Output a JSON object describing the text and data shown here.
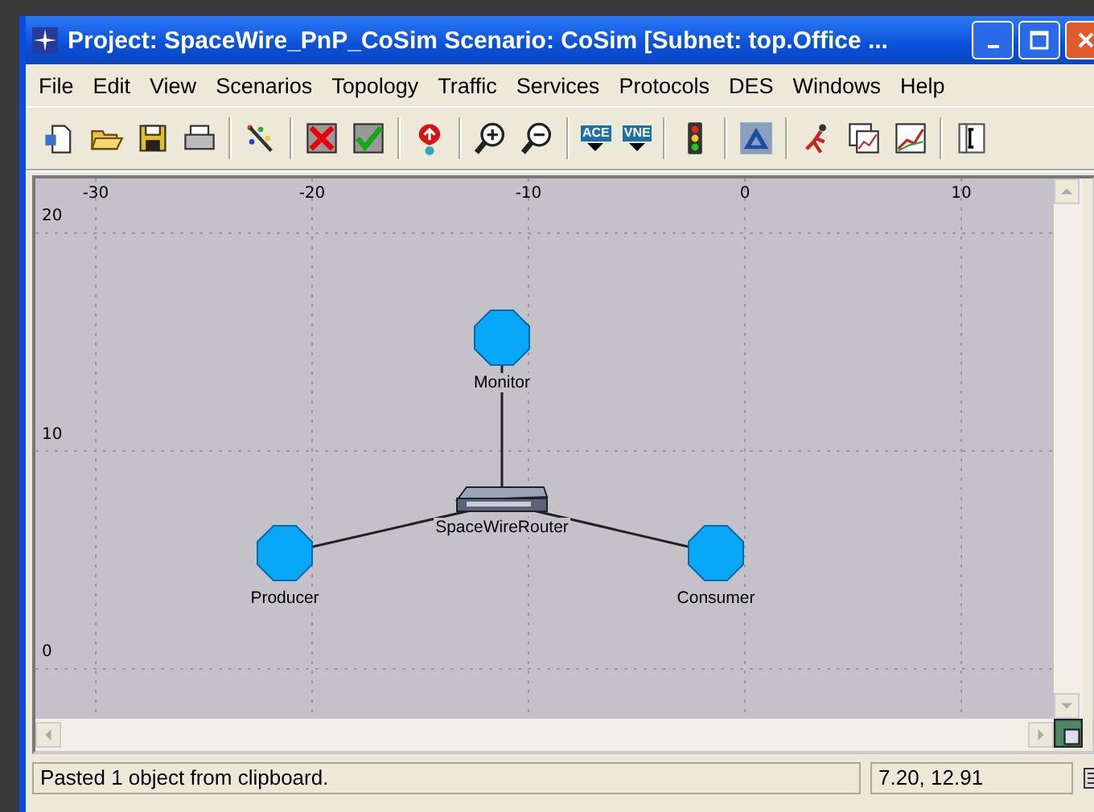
{
  "window": {
    "title": "Project: SpaceWire_PnP_CoSim Scenario: CoSim  [Subnet: top.Office ..."
  },
  "menu": [
    "File",
    "Edit",
    "View",
    "Scenarios",
    "Topology",
    "Traffic",
    "Services",
    "Protocols",
    "DES",
    "Windows",
    "Help"
  ],
  "toolbar": [
    {
      "kind": "new"
    },
    {
      "kind": "open"
    },
    {
      "kind": "save"
    },
    {
      "kind": "print"
    },
    {
      "kind": "sep"
    },
    {
      "kind": "rapid"
    },
    {
      "kind": "sep"
    },
    {
      "kind": "fail"
    },
    {
      "kind": "recover"
    },
    {
      "kind": "sep"
    },
    {
      "kind": "pin"
    },
    {
      "kind": "sep"
    },
    {
      "kind": "zoomin"
    },
    {
      "kind": "zoomout"
    },
    {
      "kind": "sep"
    },
    {
      "kind": "ace",
      "label": "ACE"
    },
    {
      "kind": "vne",
      "label": "VNE"
    },
    {
      "kind": "sep"
    },
    {
      "kind": "light"
    },
    {
      "kind": "sep"
    },
    {
      "kind": "triangle"
    },
    {
      "kind": "sep"
    },
    {
      "kind": "run"
    },
    {
      "kind": "results"
    },
    {
      "kind": "graph"
    },
    {
      "kind": "sep"
    },
    {
      "kind": "doc"
    }
  ],
  "canvas": {
    "x_axis_labels": [
      "-30",
      "-20",
      "-10",
      "0",
      "10"
    ],
    "y_axis_labels": [
      "20",
      "10",
      "0"
    ],
    "nodes": [
      {
        "name": "Monitor",
        "kind": "workstation"
      },
      {
        "name": "SpaceWireRouter",
        "kind": "router"
      },
      {
        "name": "Producer",
        "kind": "workstation"
      },
      {
        "name": "Consumer",
        "kind": "workstation"
      }
    ]
  },
  "status_bar": {
    "message": "Pasted 1 object from clipboard.",
    "coordinates": "7.20, 12.91"
  }
}
